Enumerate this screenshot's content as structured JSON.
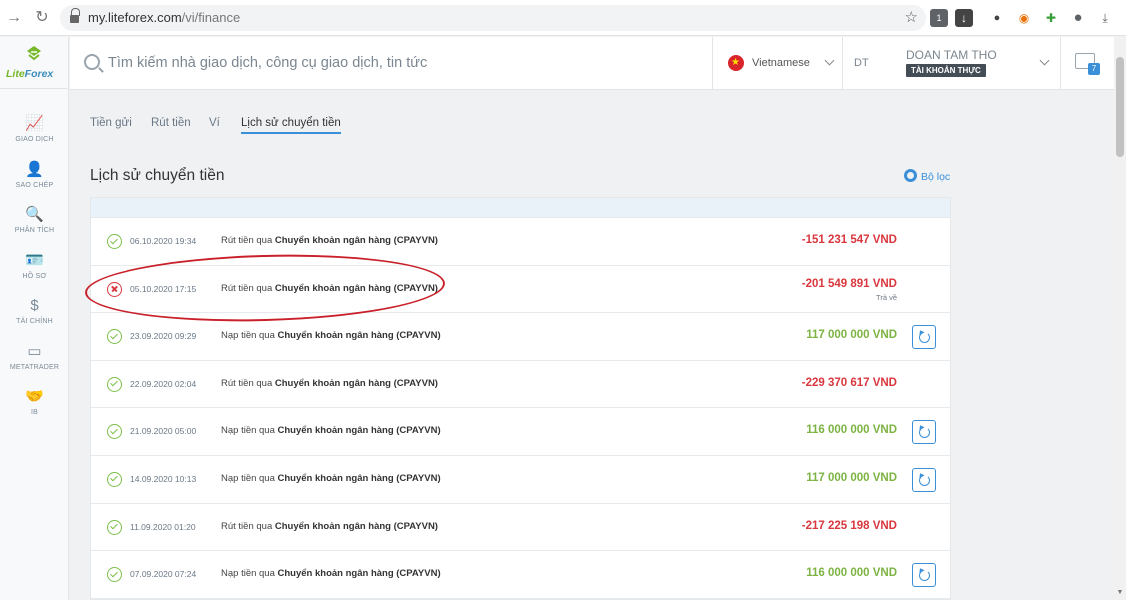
{
  "browser": {
    "url_domain": "my.liteforex.com",
    "url_path": "/vi/finance",
    "back_icon": "arrow-right-icon",
    "reload_icon": "reload-icon",
    "ext_badge": "1"
  },
  "sidebar": {
    "logo_text_a": "Lite",
    "logo_text_b": "Forex",
    "items": [
      {
        "label": "GIAO DỊCH",
        "icon": "chart-icon",
        "glyph": "📈"
      },
      {
        "label": "SAO CHÉP",
        "icon": "user-copy-icon",
        "glyph": "👤"
      },
      {
        "label": "PHÂN TÍCH",
        "icon": "analysis-icon",
        "glyph": "🔍"
      },
      {
        "label": "HỒ SƠ",
        "icon": "profile-card-icon",
        "glyph": "🪪"
      },
      {
        "label": "TÀI CHÍNH",
        "icon": "dollar-icon",
        "glyph": "$"
      },
      {
        "label": "METATRADER",
        "icon": "window-icon",
        "glyph": "▭"
      },
      {
        "label": "IB",
        "icon": "handshake-icon",
        "glyph": "🤝"
      }
    ]
  },
  "header": {
    "search_placeholder": "Tìm kiếm nhà giao dịch, công cụ giao dịch, tin tức",
    "language": "Vietnamese",
    "account_short": "DT",
    "account_name": "DOAN TAM THO",
    "account_type": "TÀI KHOẢN THỰC",
    "messages_count": "7"
  },
  "tabs": [
    {
      "label": "Tiền gửi",
      "active": false
    },
    {
      "label": "Rút tiền",
      "active": false
    },
    {
      "label": "Ví",
      "active": false
    },
    {
      "label": "Lịch sử chuyển tiền",
      "active": true
    }
  ],
  "page": {
    "title": "Lịch sử chuyển tiền",
    "filter_label": "Bộ lọc"
  },
  "transactions": [
    {
      "status": "ok",
      "date": "06.10.2020 19:34",
      "desc_prefix": "Rút tiền qua",
      "desc_method": "Chuyển khoản ngân hàng (CPAYVN)",
      "amount": "-151 231 547 VND",
      "type": "neg",
      "note": "",
      "repeat": false
    },
    {
      "status": "fail",
      "date": "05.10.2020 17:15",
      "desc_prefix": "Rút tiền qua",
      "desc_method": "Chuyển khoản ngân hàng (CPAYVN)",
      "amount": "-201 549 891 VND",
      "type": "neg",
      "note": "Trả về",
      "repeat": false
    },
    {
      "status": "ok",
      "date": "23.09.2020 09:29",
      "desc_prefix": "Nạp tiền qua",
      "desc_method": "Chuyển khoản ngân hàng (CPAYVN)",
      "amount": "117 000 000 VND",
      "type": "pos",
      "note": "",
      "repeat": true
    },
    {
      "status": "ok",
      "date": "22.09.2020 02:04",
      "desc_prefix": "Rút tiền qua",
      "desc_method": "Chuyển khoản ngân hàng (CPAYVN)",
      "amount": "-229 370 617 VND",
      "type": "neg",
      "note": "",
      "repeat": false
    },
    {
      "status": "ok",
      "date": "21.09.2020 05:00",
      "desc_prefix": "Nạp tiền qua",
      "desc_method": "Chuyển khoản ngân hàng (CPAYVN)",
      "amount": "116 000 000 VND",
      "type": "pos",
      "note": "",
      "repeat": true
    },
    {
      "status": "ok",
      "date": "14.09.2020 10:13",
      "desc_prefix": "Nạp tiền qua",
      "desc_method": "Chuyển khoản ngân hàng (CPAYVN)",
      "amount": "117 000 000 VND",
      "type": "pos",
      "note": "",
      "repeat": true
    },
    {
      "status": "ok",
      "date": "11.09.2020 01:20",
      "desc_prefix": "Rút tiền qua",
      "desc_method": "Chuyển khoản ngân hàng (CPAYVN)",
      "amount": "-217 225 198 VND",
      "type": "neg",
      "note": "",
      "repeat": false
    },
    {
      "status": "ok",
      "date": "07.09.2020 07:24",
      "desc_prefix": "Nạp tiền qua",
      "desc_method": "Chuyển khoản ngân hàng (CPAYVN)",
      "amount": "116 000 000 VND",
      "type": "pos",
      "note": "",
      "repeat": true
    }
  ],
  "colors": {
    "accent": "#3a8fd9",
    "negative": "#d9363e",
    "positive": "#7cb342",
    "brand_green": "#76b82a"
  }
}
